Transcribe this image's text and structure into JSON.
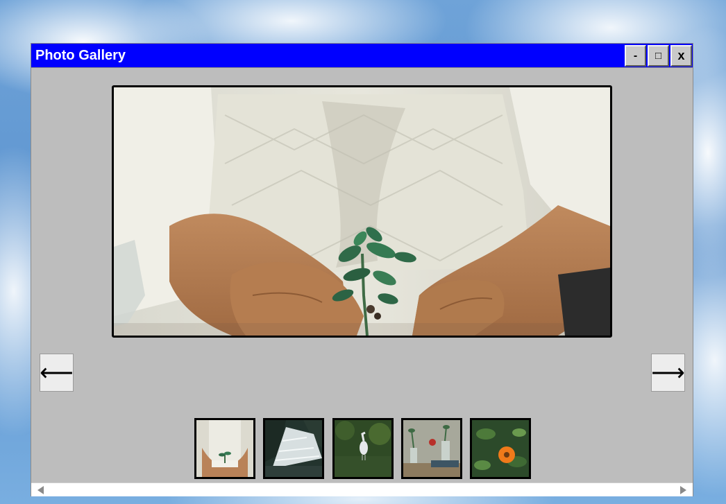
{
  "window": {
    "title": "Photo Gallery",
    "controls": {
      "minimize_label": "-",
      "maximize_label": "□",
      "close_label": "x"
    }
  },
  "gallery": {
    "main_image": {
      "icon": "photo-hands-holding-seedling"
    },
    "nav": {
      "prev_label": "⟵",
      "next_label": "⟶"
    },
    "thumbnails": [
      {
        "icon": "photo-hands-holding-seedling"
      },
      {
        "icon": "photo-waterfall"
      },
      {
        "icon": "photo-heron-in-pond"
      },
      {
        "icon": "photo-flowers-in-glass-bottles"
      },
      {
        "icon": "photo-orange-flower"
      }
    ]
  },
  "scrollbar": {
    "left_icon": "scroll-left-arrow-icon",
    "right_icon": "scroll-right-arrow-icon"
  },
  "colors": {
    "titlebar": "#0000ff",
    "window_bg": "#bdbdbd"
  }
}
